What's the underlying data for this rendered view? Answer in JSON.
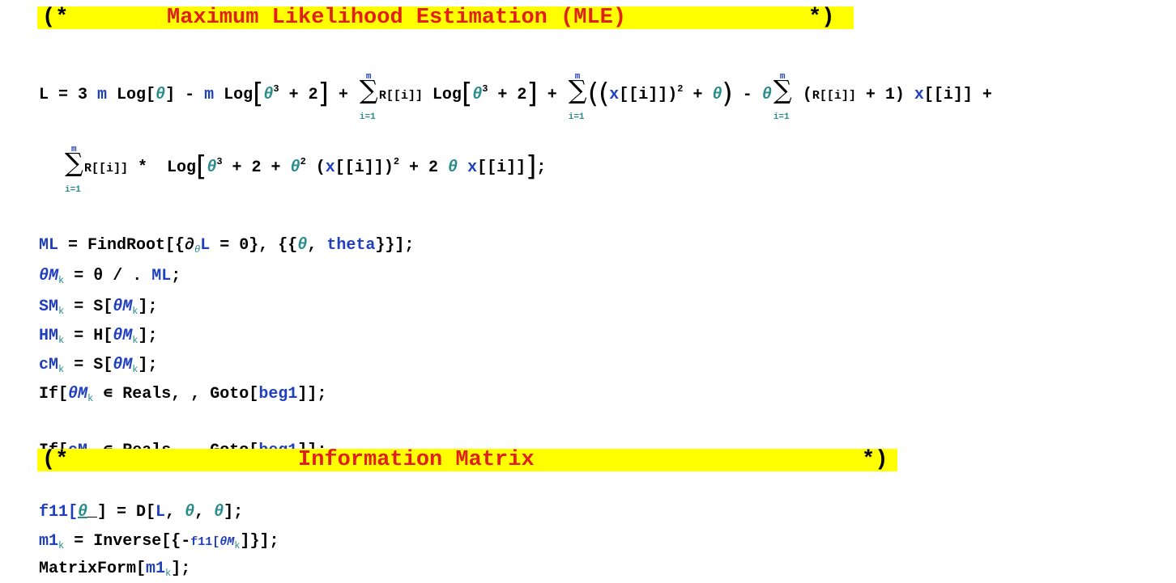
{
  "comment1": {
    "open": "(*",
    "text": "Maximum Likelihood Estimation (MLE)",
    "close": "*)"
  },
  "comment2": {
    "open": "(*",
    "text": "Information Matrix",
    "close": "*)"
  },
  "sum_limits": {
    "upper": "m",
    "lower": "i=1"
  },
  "code": {
    "L_assign": "L = 3 ",
    "m": "m",
    "log": " Log[",
    "theta": "θ",
    "close_br": "]",
    "minus": " - ",
    "log_open": " Log",
    "cube": "3",
    "plus2": " + 2",
    "plus": " + ",
    "R": "R[[i]]",
    "x": "x",
    "ii": "[[i]]",
    "sq": "2",
    "semi": ";",
    "ml_line_a": "ML = FindRoot[{∂",
    "ml_line_b": "L = 0}, {{",
    "ml_line_c": ", theta}}];",
    "thetaM_a": "θM",
    "k": "k",
    "thetaM_b": " = θ / . ",
    "ML": "ML",
    "SM": "SM",
    "HM": "HM",
    "cM": "cM",
    "eqS": " = S[",
    "eqH": " = H[",
    "endBr": "];",
    "if": "If[",
    "in_reals": " ∊ Reals, , Goto[",
    "beg1": "beg1",
    "end_if": "]];",
    "f11": "f11[",
    "f11_b": "_] = D[",
    "f11_c": ", ",
    "f11_d": "];",
    "m1": "m1",
    "m1_b": " = Inverse[{-",
    "m1_c": "f11[",
    "m1_d": "]}];",
    "mf": "MatrixForm[",
    "mf_b": "];"
  }
}
